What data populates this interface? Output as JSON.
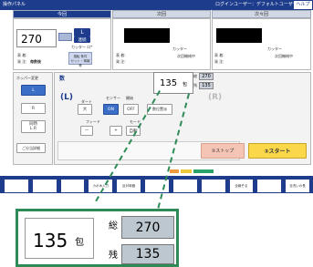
{
  "header": {
    "title": "操作パネル",
    "login": "ログインユーザー：デフォルトユーザー",
    "help": "ヘルプ"
  },
  "columns": {
    "current": "今回",
    "next": "次回",
    "after_next": "次々回"
  },
  "current_panel": {
    "count": "270",
    "mode_badge": "L",
    "mode_sub": "連続",
    "counter_label": "カッター ロ*",
    "field_a": "表 着:",
    "field_b": "発 注:",
    "field_b_value": "毎数後",
    "settings_btn": "運転 条件\nセット・情報等"
  },
  "next_panel": {
    "cutter": "カッター",
    "field_a": "表 着:",
    "field_b": "発 注:",
    "value": "次回機械中"
  },
  "after_next_panel": {
    "cutter": "カッター",
    "field_a": "表 着:",
    "field_b": "発 注:",
    "value": "次回機械中"
  },
  "hopper": {
    "title": "ホッパー変更",
    "l": "L",
    "r": "R",
    "same": "同時\nL R"
  },
  "control": {
    "count_label": "数",
    "left_mark": "(L)",
    "right_mark": "(R)",
    "dart_label": "ダート",
    "sensor_label": "センサー",
    "start_label": "開始",
    "big": "大",
    "on": "ON",
    "off": "OFF",
    "fix": "数位置派",
    "feed_label": "フィード",
    "mode_label": "モード",
    "minus": "—",
    "plus": "+",
    "auto": "自動",
    "detail": "ご分当詳細"
  },
  "counter_small": {
    "value": "135",
    "unit": "包",
    "total_label": "総",
    "total": "270",
    "remain_label": "残",
    "remain": "135"
  },
  "actions": {
    "stop": "③ストップ",
    "start": "③スタート"
  },
  "status_tags": [
    "",
    "",
    ""
  ],
  "bottom_buttons": [
    "",
    "",
    "",
    "カボ木入力",
    "反対時器",
    "",
    "",
    "",
    "全報ぞる",
    "",
    "全洗いの長"
  ],
  "zoom": {
    "value": "135",
    "unit": "包",
    "total_label": "総",
    "total": "270",
    "remain_label": "残",
    "remain": "135"
  }
}
